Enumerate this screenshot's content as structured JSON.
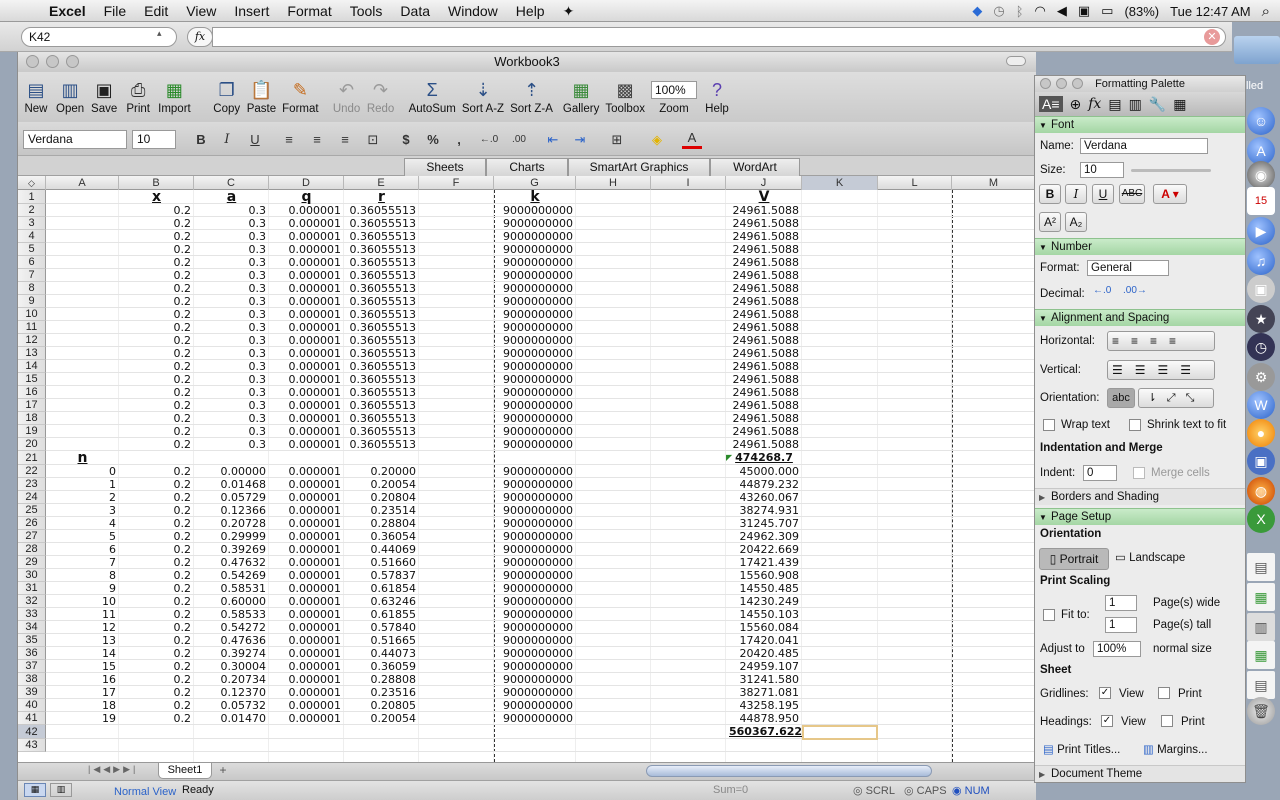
{
  "menubar": {
    "app": "Excel",
    "items": [
      "File",
      "Edit",
      "View",
      "Insert",
      "Format",
      "Tools",
      "Data",
      "Window",
      "Help"
    ],
    "battery": "(83%)",
    "clock": "Tue 12:47 AM"
  },
  "formula_bar": {
    "name_box": "K42",
    "fx": "fx",
    "formula": ""
  },
  "window": {
    "title": "Workbook3"
  },
  "toolbar": {
    "new": "New",
    "open": "Open",
    "save": "Save",
    "print": "Print",
    "import": "Import",
    "copy": "Copy",
    "paste": "Paste",
    "format": "Format",
    "undo": "Undo",
    "redo": "Redo",
    "autosum": "AutoSum",
    "sort_az": "Sort A-Z",
    "sort_za": "Sort Z-A",
    "gallery": "Gallery",
    "toolbox": "Toolbox",
    "zoom_value": "100%",
    "zoom": "Zoom",
    "help": "Help"
  },
  "format_bar": {
    "font": "Verdana",
    "size": "10",
    "bold": "B",
    "italic": "I",
    "underline": "U",
    "currency": "$",
    "percent": "%",
    "comma": ","
  },
  "ribbon_tabs": [
    "Sheets",
    "Charts",
    "SmartArt Graphics",
    "WordArt"
  ],
  "columns": [
    "A",
    "B",
    "C",
    "D",
    "E",
    "F",
    "G",
    "H",
    "I",
    "J",
    "K",
    "L",
    "M"
  ],
  "sheet": {
    "headers": {
      "B": "x",
      "C": "a",
      "D": "q",
      "E": "r",
      "G": "k",
      "J": "V"
    },
    "block1": {
      "x": "0.2",
      "a": "0.3",
      "q": "0.000001",
      "r": "0.36055513",
      "k": "9000000000",
      "V": "24961.5088"
    },
    "n_label": "n",
    "sum1": "474268.7",
    "block2": [
      [
        "0",
        "0.2",
        "0.00000",
        "0.000001",
        "0.20000",
        "9000000000",
        "45000.000"
      ],
      [
        "1",
        "0.2",
        "0.01468",
        "0.000001",
        "0.20054",
        "9000000000",
        "44879.232"
      ],
      [
        "2",
        "0.2",
        "0.05729",
        "0.000001",
        "0.20804",
        "9000000000",
        "43260.067"
      ],
      [
        "3",
        "0.2",
        "0.12366",
        "0.000001",
        "0.23514",
        "9000000000",
        "38274.931"
      ],
      [
        "4",
        "0.2",
        "0.20728",
        "0.000001",
        "0.28804",
        "9000000000",
        "31245.707"
      ],
      [
        "5",
        "0.2",
        "0.29999",
        "0.000001",
        "0.36054",
        "9000000000",
        "24962.309"
      ],
      [
        "6",
        "0.2",
        "0.39269",
        "0.000001",
        "0.44069",
        "9000000000",
        "20422.669"
      ],
      [
        "7",
        "0.2",
        "0.47632",
        "0.000001",
        "0.51660",
        "9000000000",
        "17421.439"
      ],
      [
        "8",
        "0.2",
        "0.54269",
        "0.000001",
        "0.57837",
        "9000000000",
        "15560.908"
      ],
      [
        "9",
        "0.2",
        "0.58531",
        "0.000001",
        "0.61854",
        "9000000000",
        "14550.485"
      ],
      [
        "10",
        "0.2",
        "0.60000",
        "0.000001",
        "0.63246",
        "9000000000",
        "14230.249"
      ],
      [
        "11",
        "0.2",
        "0.58533",
        "0.000001",
        "0.61855",
        "9000000000",
        "14550.103"
      ],
      [
        "12",
        "0.2",
        "0.54272",
        "0.000001",
        "0.57840",
        "9000000000",
        "15560.084"
      ],
      [
        "13",
        "0.2",
        "0.47636",
        "0.000001",
        "0.51665",
        "9000000000",
        "17420.041"
      ],
      [
        "14",
        "0.2",
        "0.39274",
        "0.000001",
        "0.44073",
        "9000000000",
        "20420.485"
      ],
      [
        "15",
        "0.2",
        "0.30004",
        "0.000001",
        "0.36059",
        "9000000000",
        "24959.107"
      ],
      [
        "16",
        "0.2",
        "0.20734",
        "0.000001",
        "0.28808",
        "9000000000",
        "31241.580"
      ],
      [
        "17",
        "0.2",
        "0.12370",
        "0.000001",
        "0.23516",
        "9000000000",
        "38271.081"
      ],
      [
        "18",
        "0.2",
        "0.05732",
        "0.000001",
        "0.20805",
        "9000000000",
        "43258.195"
      ],
      [
        "19",
        "0.2",
        "0.01470",
        "0.000001",
        "0.20054",
        "9000000000",
        "44878.950"
      ]
    ],
    "sum2": "560367.622"
  },
  "sheet_tab": "Sheet1",
  "status": {
    "view": "Normal View",
    "ready": "Ready",
    "sum": "Sum=0",
    "scrl": "SCRL",
    "caps": "CAPS",
    "num": "NUM"
  },
  "palette": {
    "title": "Formatting Palette",
    "font_section": "Font",
    "name_label": "Name:",
    "name_value": "Verdana",
    "size_label": "Size:",
    "size_value": "10",
    "number_section": "Number",
    "format_label": "Format:",
    "format_value": "General",
    "decimal_label": "Decimal:",
    "align_section": "Alignment and Spacing",
    "horizontal_label": "Horizontal:",
    "vertical_label": "Vertical:",
    "orientation_label": "Orientation:",
    "orientation_abc": "abc",
    "wrap_text": "Wrap text",
    "shrink_text": "Shrink text to fit",
    "indent_merge": "Indentation and Merge",
    "indent_label": "Indent:",
    "indent_value": "0",
    "merge_cells": "Merge cells",
    "borders_section": "Borders and Shading",
    "page_setup": "Page Setup",
    "orientation_sub": "Orientation",
    "portrait": "Portrait",
    "landscape": "Landscape",
    "print_scaling": "Print Scaling",
    "fit_to": "Fit to:",
    "wide_value": "1",
    "wide_label": "Page(s) wide",
    "tall_value": "1",
    "tall_label": "Page(s) tall",
    "adjust_to": "Adjust to",
    "adjust_value": "100%",
    "normal_size": "normal size",
    "sheet_sub": "Sheet",
    "gridlines": "Gridlines:",
    "headings": "Headings:",
    "view": "View",
    "print": "Print",
    "print_titles": "Print Titles...",
    "margins": "Margins...",
    "document_theme": "Document Theme"
  },
  "desktop": {
    "label": "lled"
  }
}
